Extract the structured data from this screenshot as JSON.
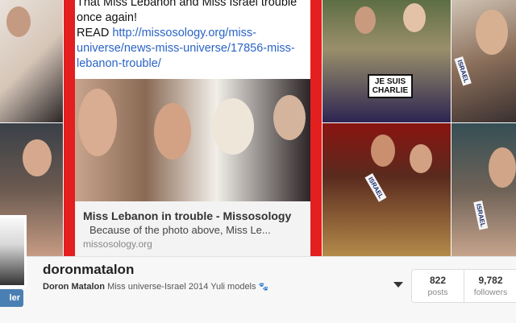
{
  "post": {
    "text_line1": "That Miss Lebanon and Miss Israel trouble",
    "text_line2": "once again!",
    "read_label": "READ",
    "link": "http://missosology.org/miss-universe/news-miss-universe/17856-miss-lebanon-trouble/",
    "card_title": "Miss Lebanon in trouble - Missosology",
    "card_desc": "Because of the photo above, Miss Le...",
    "card_domain": "missosology.org"
  },
  "tiles": {
    "sign_text": "JE SUIS CHARLIE",
    "sash_text": "ISRAEL"
  },
  "profile": {
    "username": "doronmatalon",
    "display_name": "Doron Matalon",
    "bio": "Miss universe-Israel 2014 Yuli models",
    "follow_label": "ler",
    "posts_count": "822",
    "posts_label": "posts",
    "followers_count": "9,782",
    "followers_label": "followers"
  },
  "colors": {
    "frame_red": "#e41f1f",
    "link_blue": "#2a63c6",
    "follow_blue": "#4a7fb3"
  }
}
